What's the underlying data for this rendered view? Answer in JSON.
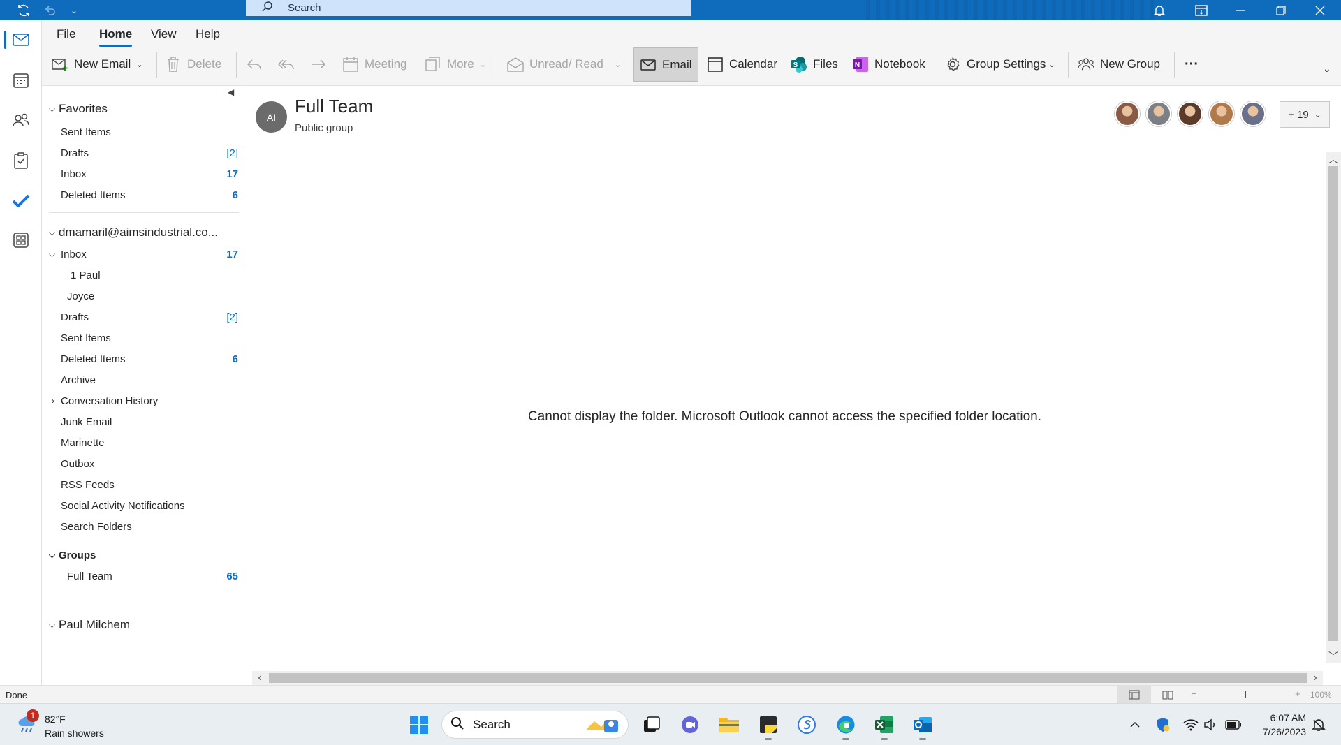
{
  "titlebar": {
    "search_placeholder": "Search",
    "accent_color": "#0f6cbd"
  },
  "rail": {
    "items": [
      "mail-icon",
      "calendar-icon",
      "people-icon",
      "tasks-icon",
      "todo-icon",
      "apps-icon"
    ]
  },
  "menu": {
    "tabs": [
      "File",
      "Home",
      "View",
      "Help"
    ],
    "active": "Home"
  },
  "ribbon": {
    "new_email": "New Email",
    "delete": "Delete",
    "meeting": "Meeting",
    "more": "More",
    "unread_read": "Unread/ Read",
    "email": "Email",
    "calendar": "Calendar",
    "files": "Files",
    "notebook": "Notebook",
    "group_settings": "Group Settings",
    "new_group": "New Group",
    "overflow": "···"
  },
  "folders": {
    "favorites": {
      "label": "Favorites",
      "items": [
        {
          "label": "Sent Items",
          "count": ""
        },
        {
          "label": "Drafts",
          "count": "[2]"
        },
        {
          "label": "Inbox",
          "count": "17"
        },
        {
          "label": "Deleted Items",
          "count": "6"
        }
      ]
    },
    "account": {
      "label": "dmamaril@aimsindustrial.co...",
      "inbox": {
        "label": "Inbox",
        "count": "17"
      },
      "subfolders": [
        "1 Paul",
        "Joyce"
      ],
      "items": [
        {
          "label": "Drafts",
          "count": "[2]"
        },
        {
          "label": "Sent Items",
          "count": ""
        },
        {
          "label": "Deleted Items",
          "count": "6"
        },
        {
          "label": "Archive",
          "count": ""
        },
        {
          "label": "Conversation History",
          "count": ""
        },
        {
          "label": "Junk Email",
          "count": ""
        },
        {
          "label": "Marinette",
          "count": ""
        },
        {
          "label": "Outbox",
          "count": ""
        },
        {
          "label": "RSS Feeds",
          "count": ""
        },
        {
          "label": "Social Activity Notifications",
          "count": ""
        },
        {
          "label": "Search Folders",
          "count": ""
        }
      ]
    },
    "groups": {
      "label": "Groups",
      "items": [
        {
          "label": "Full Team",
          "count": "65"
        }
      ]
    },
    "other_account": {
      "label": "Paul Milchem"
    }
  },
  "group": {
    "initials": "AI",
    "title": "Full Team",
    "subtitle": "Public group",
    "more_members": "+ 19",
    "member_colors": [
      "#8a5a44",
      "#7c7f86",
      "#5d3b2a",
      "#b07a4a",
      "#6a6f8a"
    ]
  },
  "main": {
    "message": "Cannot display the folder. Microsoft Outlook cannot access the specified folder location."
  },
  "status": {
    "text": "Done",
    "zoom": "100%"
  },
  "taskbar": {
    "weather_badge": "1",
    "temperature": "82°F",
    "condition": "Rain showers",
    "search": "Search",
    "time": "6:07 AM",
    "date": "7/26/2023"
  }
}
